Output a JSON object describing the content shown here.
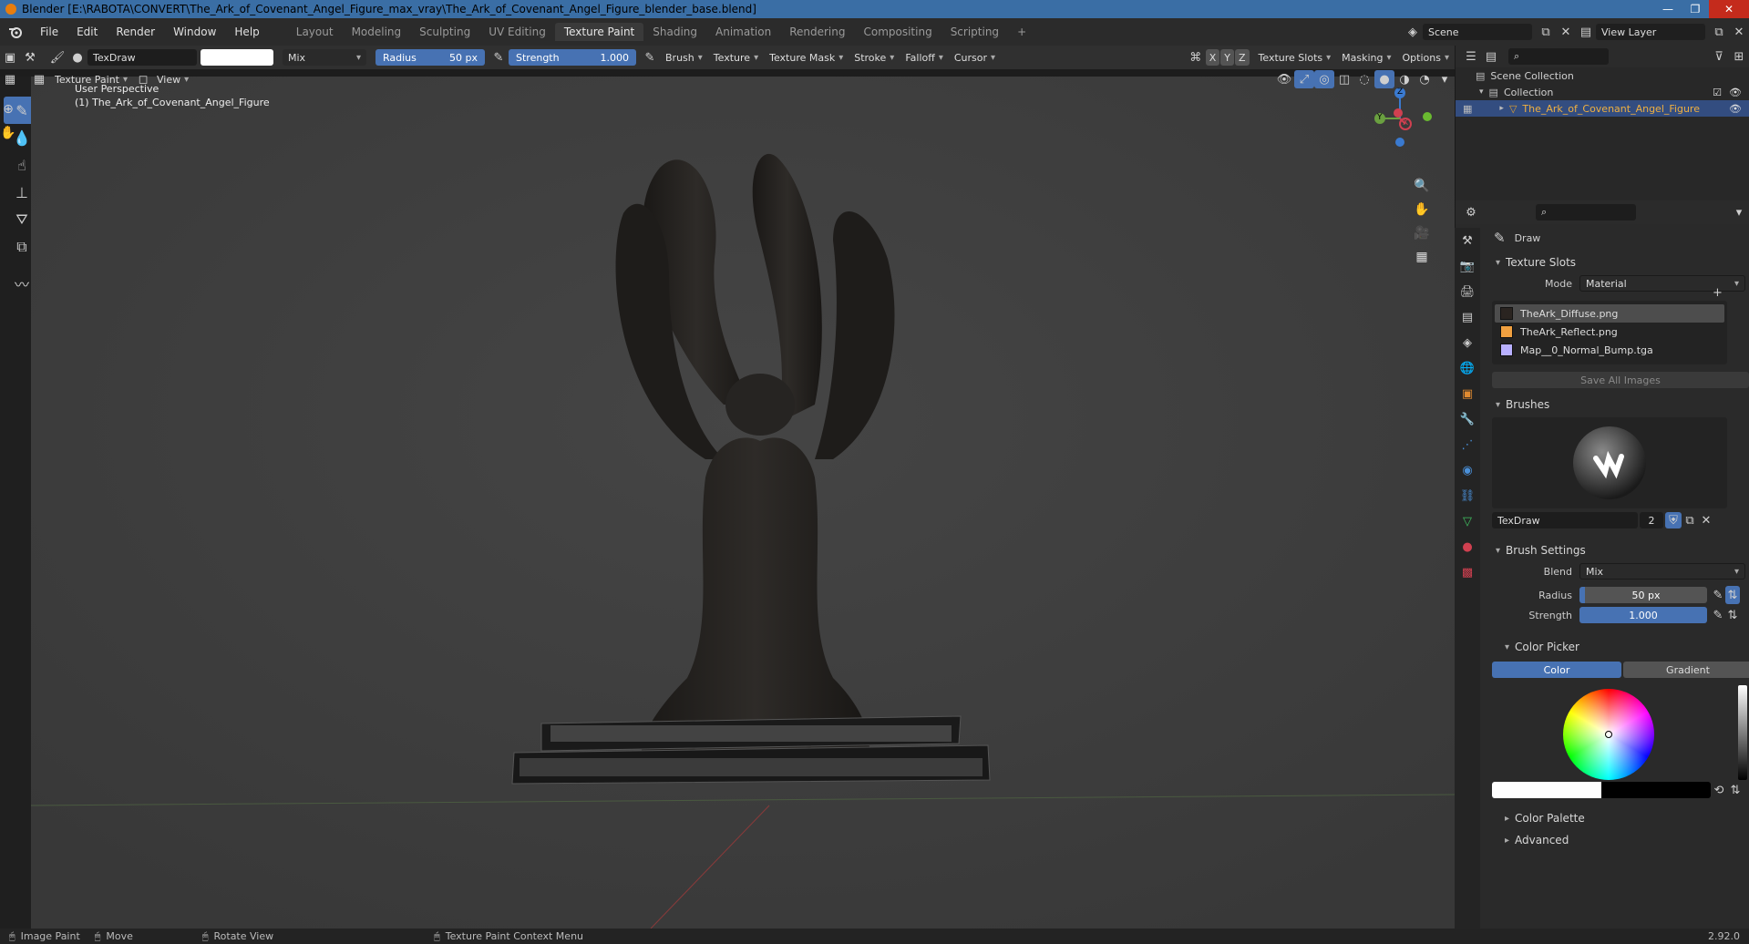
{
  "window": {
    "title": "Blender [E:\\RABOTA\\CONVERT\\The_Ark_of_Covenant_Angel_Figure_max_vray\\The_Ark_of_Covenant_Angel_Figure_blender_base.blend]"
  },
  "menu": [
    "File",
    "Edit",
    "Render",
    "Window",
    "Help"
  ],
  "workspaces": [
    "Layout",
    "Modeling",
    "Sculpting",
    "UV Editing",
    "Texture Paint",
    "Shading",
    "Animation",
    "Rendering",
    "Compositing",
    "Scripting"
  ],
  "active_workspace": "Texture Paint",
  "scene": {
    "name": "Scene",
    "view_layer": "View Layer"
  },
  "tool_header": {
    "brush_name": "TexDraw",
    "blend": "Mix",
    "radius_label": "Radius",
    "radius_value": "50 px",
    "strength_label": "Strength",
    "strength_value": "1.000",
    "menus": [
      "Brush",
      "Texture",
      "Texture Mask",
      "Stroke",
      "Falloff",
      "Cursor"
    ],
    "axes": [
      "X",
      "Y",
      "Z"
    ],
    "right_menus": [
      "Texture Slots",
      "Masking",
      "Options"
    ]
  },
  "view_header": {
    "mode": "Texture Paint",
    "view": "View"
  },
  "viewport": {
    "perspective": "User Perspective",
    "object_label": "(1) The_Ark_of_Covenant_Angel_Figure",
    "gizmo": {
      "z": "Z",
      "y": "Y",
      "x": "X"
    }
  },
  "outliner": {
    "root": "Scene Collection",
    "collection": "Collection",
    "object": "The_Ark_of_Covenant_Angel_Figure"
  },
  "properties": {
    "tool_name": "Draw",
    "texture_slots": {
      "header": "Texture Slots",
      "mode_label": "Mode",
      "mode_value": "Material",
      "items": [
        {
          "name": "TheArk_Diffuse.png",
          "color": "#2a2420",
          "selected": true
        },
        {
          "name": "TheArk_Reflect.png",
          "color": "#f0a040",
          "selected": false
        },
        {
          "name": "Map__0_Normal_Bump.tga",
          "color": "#b8b0ff",
          "selected": false
        }
      ],
      "save_all": "Save All Images"
    },
    "brushes": {
      "header": "Brushes",
      "name": "TexDraw",
      "users": "2"
    },
    "brush_settings": {
      "header": "Brush Settings",
      "blend_label": "Blend",
      "blend_value": "Mix",
      "radius_label": "Radius",
      "radius_value": "50 px",
      "strength_label": "Strength",
      "strength_value": "1.000"
    },
    "color_picker": {
      "header": "Color Picker",
      "tab_color": "Color",
      "tab_gradient": "Gradient"
    },
    "color_palette": "Color Palette",
    "advanced": "Advanced"
  },
  "statusbar": {
    "items": [
      "Image Paint",
      "Move",
      "Rotate View",
      "Texture Paint Context Menu"
    ],
    "version": "2.92.0"
  },
  "colors": {
    "accent": "#4772b3",
    "object_highlight": "#e0a030"
  }
}
